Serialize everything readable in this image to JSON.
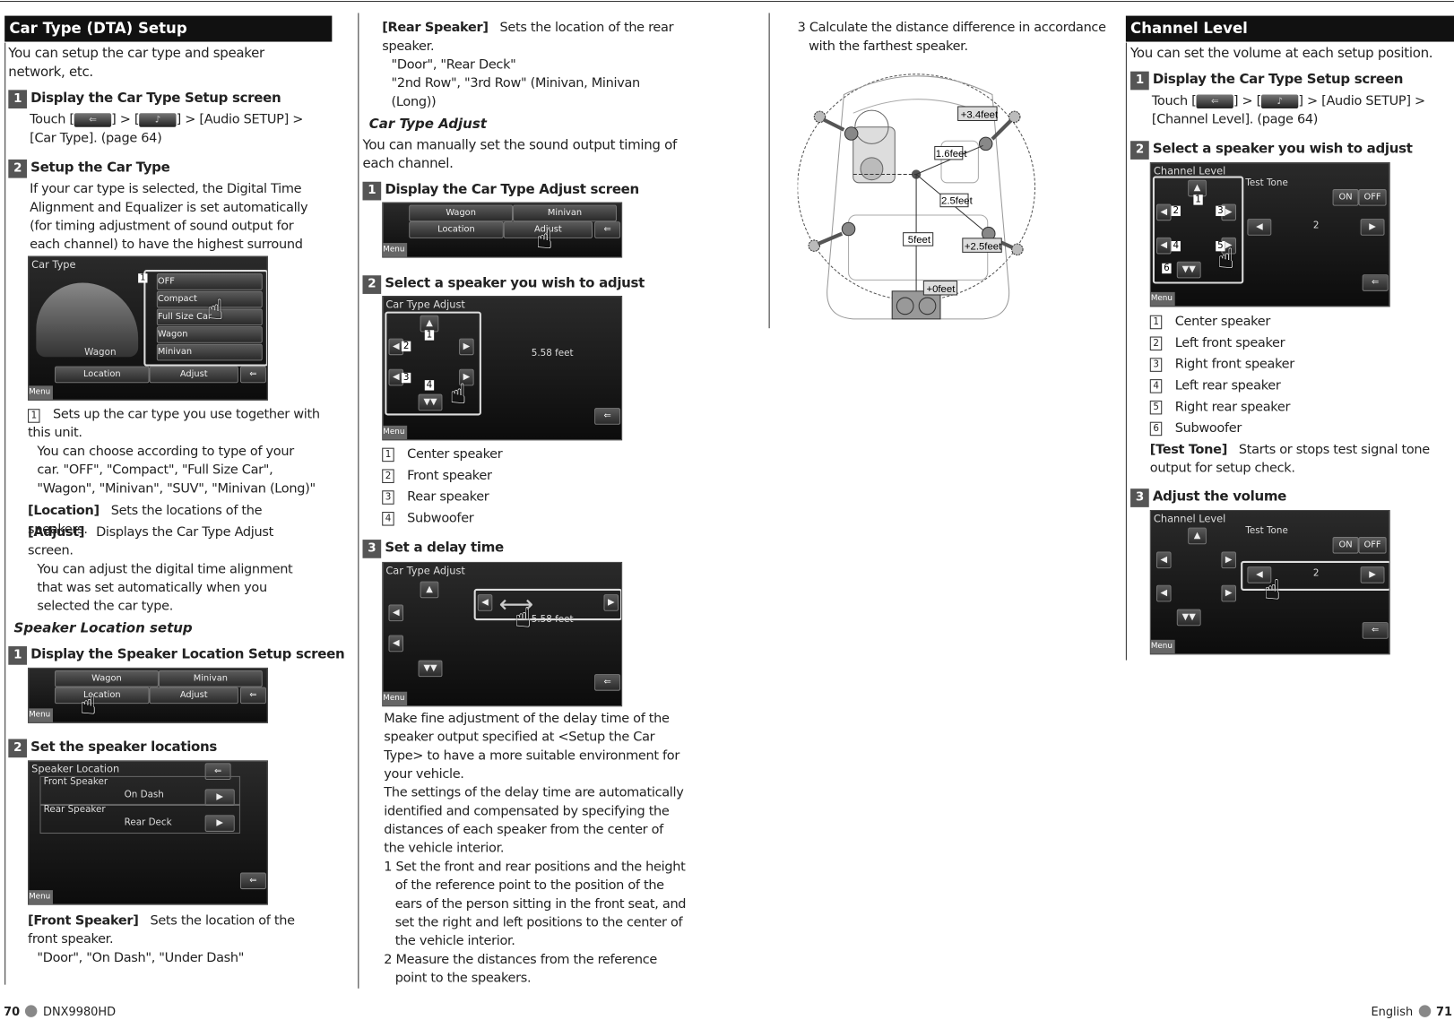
{
  "left": {
    "title": "Car Type (DTA) Setup",
    "intro": "You can setup the car type and speaker network, etc.",
    "step1": {
      "num": "1",
      "title": "Display the Car Type Setup screen",
      "touch": "Touch [",
      "mid": "] > [",
      "end": "] > [Audio SETUP] > [Car Type]. (page 64)"
    },
    "step2": {
      "num": "2",
      "title": "Setup the Car Type",
      "text": "If your car type is selected, the Digital Time Alignment and Equalizer is set automatically (for timing adjustment of sound output for each channel) to have the highest surround effects."
    },
    "shot1": {
      "title": "Car Type",
      "options": [
        "OFF",
        "Compact",
        "Full Size Car",
        "Wagon",
        "Minivan"
      ],
      "selected": "Wagon",
      "location": "Location",
      "adjust": "Adjust",
      "menu": "Menu",
      "marker": "1"
    },
    "note1": {
      "num": "1",
      "text": "Sets up the car type you use together with this unit.",
      "more": "You can choose according to type of your car. \"OFF\", \"Compact\", \"Full Size Car\", \"Wagon\", \"Minivan\", \"SUV\", \"Minivan (Long)\""
    },
    "location": {
      "label": "[Location]",
      "text": "Sets the locations of the speakers."
    },
    "adjust": {
      "label": "[Adjust]",
      "text": "Displays the Car Type Adjust screen.",
      "more": "You can adjust the digital time alignment that was set automatically when you selected the car type."
    },
    "speaker_location": {
      "title": "Speaker Location setup",
      "step1": {
        "num": "1",
        "title": "Display the Speaker Location Setup screen"
      },
      "shot": {
        "wagon": "Wagon",
        "minivan": "Minivan",
        "location": "Location",
        "adjust": "Adjust",
        "menu": "Menu"
      },
      "step2": {
        "num": "2",
        "title": "Set the speaker locations"
      },
      "shot2": {
        "title": "Speaker Location",
        "front": "Front Speaker",
        "front_val": "On Dash",
        "rear": "Rear Speaker",
        "rear_val": "Rear Deck",
        "menu": "Menu"
      },
      "front": {
        "label": "[Front Speaker]",
        "text": "Sets the location of the front speaker.",
        "opts": "\"Door\", \"On Dash\", \"Under Dash\""
      }
    }
  },
  "mid": {
    "rear": {
      "label": "[Rear Speaker]",
      "text": "Sets the location of the rear speaker.",
      "opts1": "\"Door\", \"Rear Deck\"",
      "opts2": "\"2nd Row\", \"3rd Row\" (Minivan, Minivan (Long))"
    },
    "title": "Car Type Adjust",
    "intro": "You can manually set the sound output timing of each channel.",
    "step1": {
      "num": "1",
      "title": "Display the Car Type Adjust screen"
    },
    "shot1": {
      "wagon": "Wagon",
      "minivan": "Minivan",
      "location": "Location",
      "adjust": "Adjust",
      "menu": "Menu"
    },
    "step2": {
      "num": "2",
      "title": "Select a speaker you wish to adjust"
    },
    "shot2": {
      "title": "Car Type Adjust",
      "value": "5.58 feet",
      "menu": "Menu",
      "markers": [
        "1",
        "2",
        "3",
        "4"
      ]
    },
    "list": [
      {
        "n": "1",
        "t": "Center speaker"
      },
      {
        "n": "2",
        "t": "Front speaker"
      },
      {
        "n": "3",
        "t": "Rear speaker"
      },
      {
        "n": "4",
        "t": "Subwoofer"
      }
    ],
    "step3": {
      "num": "3",
      "title": "Set a delay time"
    },
    "shot3": {
      "title": "Car Type Adjust",
      "value": "5.58 feet",
      "menu": "Menu"
    },
    "para1": "Make fine adjustment of the delay time of the speaker output specified at <Setup the Car Type> to have a more suitable environment for your vehicle.",
    "para2": "The settings of the delay time are automatically identified and compensated by specifying the distances of each speaker from the center of the vehicle interior.",
    "item1": "1 Set the front and rear positions and the height of the reference point to the position of the ears of the person sitting in the front seat, and set the right and left positions to the center of the vehicle interior.",
    "item2": "2 Measure the distances from the reference point to the speakers."
  },
  "third": {
    "item3": "3 Calculate the distance difference in accordance with the farthest speaker.",
    "diagram": {
      "labels": [
        "+3.4feet",
        "1.6feet",
        "2.5feet",
        "5feet",
        "+2.5feet",
        "+0feet"
      ]
    }
  },
  "right": {
    "title": "Channel Level",
    "intro": "You can set the volume at each setup position.",
    "step1": {
      "num": "1",
      "title": "Display the Car Type Setup screen",
      "touch": "Touch [",
      "mid": "] > [",
      "end": "] > [Audio SETUP] > [Channel Level]. (page 64)"
    },
    "step2": {
      "num": "2",
      "title": "Select a speaker you wish to adjust"
    },
    "shot": {
      "title": "Channel Level",
      "test_tone": "Test Tone",
      "on": "ON",
      "off": "OFF",
      "value": "2",
      "menu": "Menu",
      "markers": [
        "1",
        "2",
        "3",
        "4",
        "5",
        "6"
      ]
    },
    "list": [
      {
        "n": "1",
        "t": "Center speaker"
      },
      {
        "n": "2",
        "t": "Left front speaker"
      },
      {
        "n": "3",
        "t": "Right front speaker"
      },
      {
        "n": "4",
        "t": "Left rear speaker"
      },
      {
        "n": "5",
        "t": "Right rear speaker"
      },
      {
        "n": "6",
        "t": "Subwoofer"
      }
    ],
    "test": {
      "label": "[Test Tone]",
      "text": "Starts or stops test signal tone output for setup check."
    },
    "step3": {
      "num": "3",
      "title": "Adjust the volume"
    }
  },
  "footer": {
    "left_page": "70",
    "model": "DNX9980HD",
    "lang": "English",
    "right_page": "71"
  }
}
